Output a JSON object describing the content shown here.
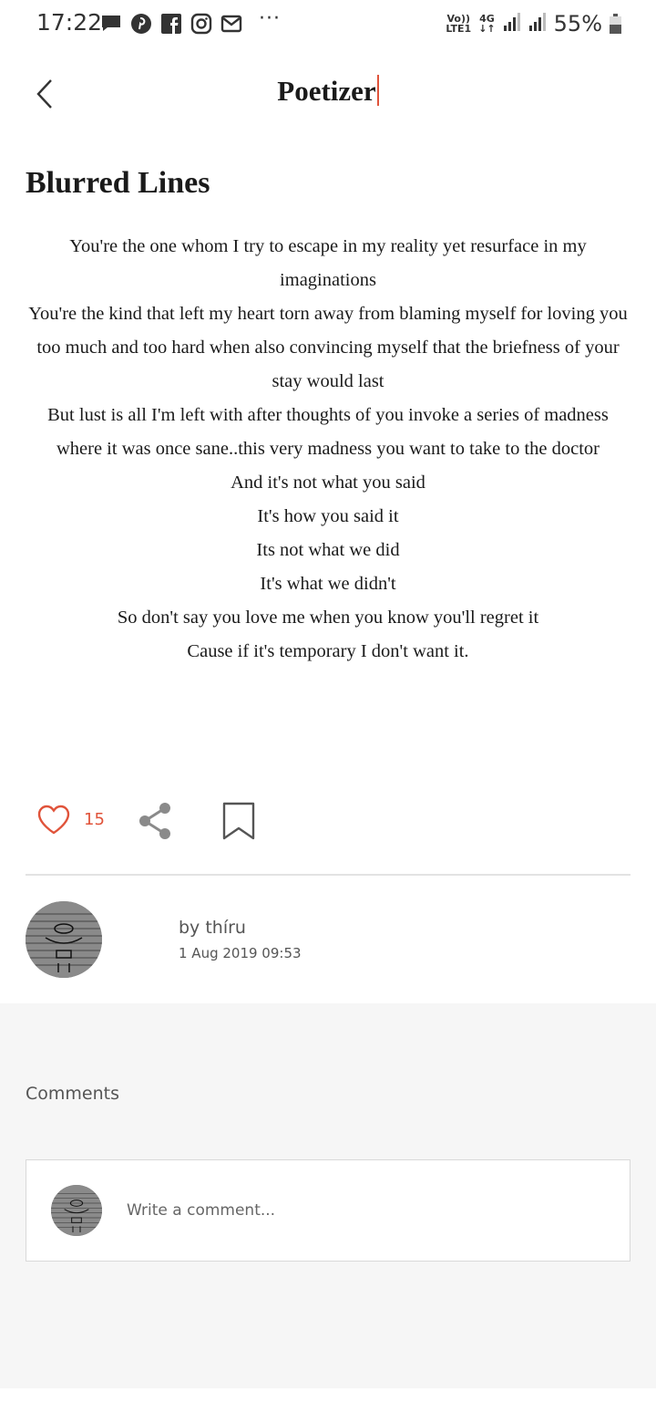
{
  "status_bar": {
    "time": "17:22",
    "left_icons": [
      "message-icon",
      "pinterest-icon",
      "facebook-icon",
      "instagram-icon",
      "gmail-icon"
    ],
    "more": "···",
    "volte_top": "Vo))",
    "volte_bottom": "LTE1",
    "net_top": "4G",
    "net_bottom": "↓↑",
    "battery": "55%"
  },
  "header": {
    "title": "Poetizer",
    "back_icon": "chevron-left-icon"
  },
  "poem": {
    "title": "Blurred Lines",
    "lines": [
      "You're the one whom I try to escape in my reality yet resurface in my imaginations",
      "You're the kind that left my heart torn away from blaming myself for loving you too much and too hard when also convincing myself that the briefness of your stay would last",
      "But lust is all I'm left with after thoughts of you invoke a series of madness where it was once sane..this very madness you want to take to the doctor",
      "And it's not what you said",
      "It's how you said it",
      "Its not what we did",
      "It's what we didn't",
      "So don't say you love me when you know you'll regret it",
      "Cause if it's temporary I don't want it."
    ]
  },
  "actions": {
    "like_count": "15",
    "like_icon": "heart-icon",
    "share_icon": "share-icon",
    "bookmark_icon": "bookmark-icon",
    "accent": "#e0533a"
  },
  "author": {
    "by": "by thíru",
    "date": "1 Aug 2019 09:53"
  },
  "comments": {
    "heading": "Comments",
    "placeholder": "Write a comment..."
  }
}
